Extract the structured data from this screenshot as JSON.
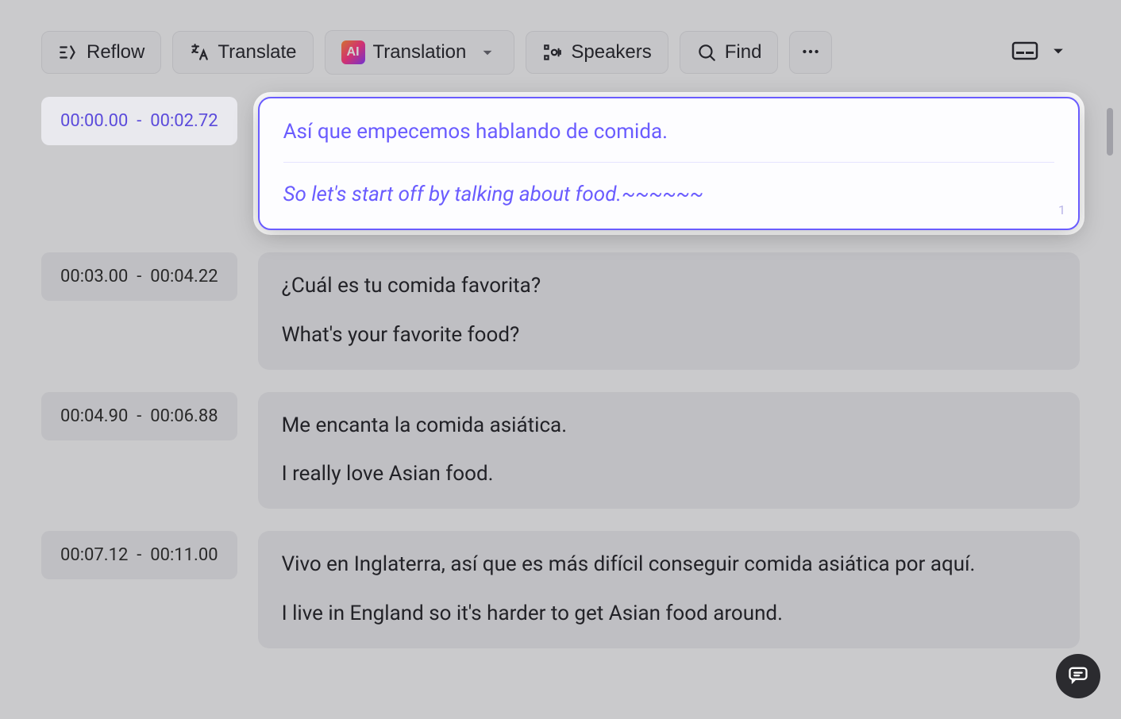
{
  "toolbar": {
    "reflow_label": "Reflow",
    "translate_label": "Translate",
    "translation_label": "Translation",
    "speakers_label": "Speakers",
    "find_label": "Find",
    "ai_badge_text": "AI"
  },
  "segments": [
    {
      "start": "00:00.00",
      "end": "00:02.72",
      "source": "Así que empecemos hablando de comida.",
      "target": "So let's start off by talking about food.~~~~~~",
      "line_number": "1",
      "active": true
    },
    {
      "start": "00:03.00",
      "end": "00:04.22",
      "source": "¿Cuál es tu comida favorita?",
      "target": "What's your favorite food?",
      "active": false
    },
    {
      "start": "00:04.90",
      "end": "00:06.88",
      "source": "Me encanta la comida asiática.",
      "target": "I really love Asian food.",
      "active": false
    },
    {
      "start": "00:07.12",
      "end": "00:11.00",
      "source": "Vivo en Inglaterra, así que es más difícil conseguir comida asiática por aquí.",
      "target": "I live in England so it's harder to get Asian food around.",
      "active": false
    }
  ]
}
